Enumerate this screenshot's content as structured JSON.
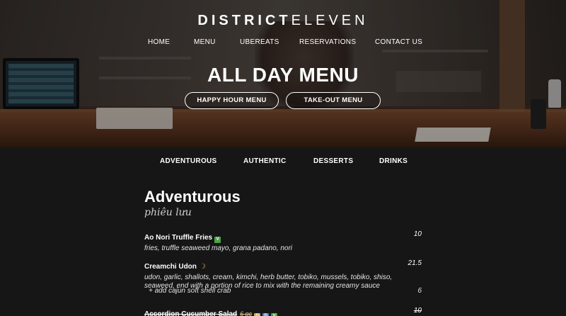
{
  "brand": {
    "part1": "DISTRICT",
    "part2": "ELEVEN"
  },
  "nav": [
    {
      "label": "HOME"
    },
    {
      "label": "MENU"
    },
    {
      "label": "UBEREATS"
    },
    {
      "label": "RESERVATIONS"
    },
    {
      "label": "CONTACT US"
    }
  ],
  "hero": {
    "title": "ALL DAY MENU",
    "button_happy": "HAPPY HOUR MENU",
    "button_takeout": "TAKE-OUT MENU"
  },
  "categories": [
    {
      "label": "ADVENTUROUS"
    },
    {
      "label": "AUTHENTIC"
    },
    {
      "label": "DESSERTS"
    },
    {
      "label": "DRINKS"
    }
  ],
  "section": {
    "title": "Adventurous",
    "subtitle": "phiêu lưu"
  },
  "items": [
    {
      "name": "Ao Nori Truffle Fries",
      "price": "10",
      "desc": "fries, truffle seaweed mayo, grana padano, nori",
      "badges": [
        "v-icon"
      ]
    },
    {
      "name": "Creamchi Udon",
      "price": "21.5",
      "desc1": "udon, garlic, shallots, cream, kimchi, herb butter, tobiko, mussels, tobiko, shiso,",
      "desc2": "seaweed, end with a portion of rice to mix with the remaining creamy sauce",
      "badges": [
        "spicy-moon-icon"
      ],
      "addon": {
        "label": "+ add cajun soft shell crab",
        "price": "6"
      }
    },
    {
      "name": "Accordion Cucumber Salad",
      "was": "6 pc",
      "price": "10",
      "badges": [
        "gf-icon",
        "df-icon",
        "v-icon"
      ]
    }
  ],
  "colors": {
    "background": "#161616",
    "vegan_badge": "#4aa342",
    "gluten_badge": "#d6a73a",
    "dairy_badge": "#3d8fd1",
    "spicy": "#e7b24a"
  }
}
